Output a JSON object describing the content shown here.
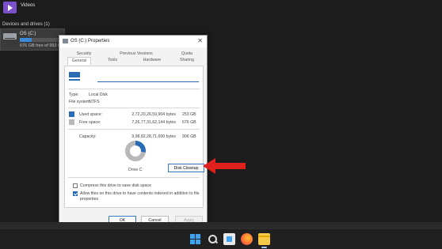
{
  "explorer": {
    "videos_label": "Videos",
    "section_header": "Devices and drives (1)",
    "drive": {
      "name": "OS (C:)",
      "free_text": "676 GB free of 953 GB",
      "used_fraction": 0.27
    }
  },
  "dialog": {
    "title": "OS (C:) Properties",
    "close_glyph": "✕",
    "tabs": {
      "security": "Security",
      "previous_versions": "Previous Versions",
      "quota": "Quota",
      "general": "General",
      "tools": "Tools",
      "hardware": "Hardware",
      "sharing": "Sharing"
    },
    "label_value": "",
    "type_label": "Type:",
    "type_value": "Local Disk",
    "fs_label": "File system:",
    "fs_value": "NTFS",
    "used": {
      "label": "Used space:",
      "bytes": "2,72,20,26,59,904 bytes",
      "gb": "253 GB",
      "color": "#2a6bb5"
    },
    "free": {
      "label": "Free space:",
      "bytes": "7,26,77,31,62,144 bytes",
      "gb": "676 GB",
      "color": "#b8b8b8"
    },
    "capacity": {
      "label": "Capacity:",
      "bytes": "9,98,82,28,71,600 bytes",
      "gb": "906 GB"
    },
    "used_fraction": 0.27,
    "drive_label": "Drive C:",
    "disk_cleanup_label": "Disk Cleanup",
    "compress_label": "Compress this drive to save disk space",
    "compress_checked": false,
    "index_label": "Allow files on this drive to have contents indexed in addition to file properties",
    "index_checked": true,
    "ok_label": "OK",
    "cancel_label": "Cancel",
    "apply_label": "Apply"
  },
  "annotation": {
    "arrow_color": "#e0201b"
  },
  "taskbar": {
    "icons": [
      "windows-start-icon",
      "search-icon",
      "store-icon",
      "firefox-icon",
      "file-explorer-icon"
    ]
  }
}
